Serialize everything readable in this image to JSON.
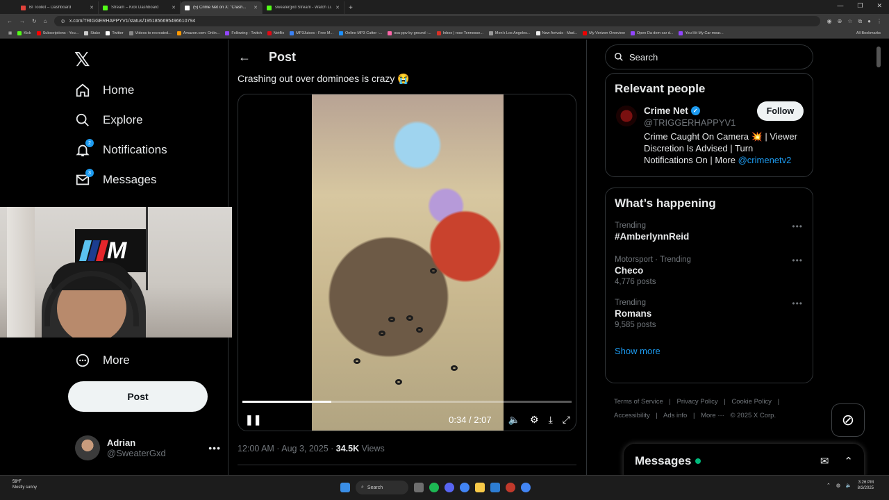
{
  "browser": {
    "tabs": [
      {
        "label": "BI Toolkit – Dashboard",
        "color": "#e0433b",
        "active": false
      },
      {
        "label": "Stream – Kick Dashboard",
        "color": "#53fc18",
        "active": false
      },
      {
        "label": "(5) Crime Net on X: \"Crash...",
        "color": "#ffffff",
        "active": true
      },
      {
        "label": "sweatergxd Stream - Watch Li...",
        "color": "#53fc18",
        "active": false
      }
    ],
    "url": "x.com/TRIGGERHAPPYV1/status/1951856695496610794",
    "bookmarks": [
      {
        "label": "Kick",
        "color": "#53fc18"
      },
      {
        "label": "Subscriptions - You...",
        "color": "#ff0000"
      },
      {
        "label": "Stake",
        "color": "#cccccc"
      },
      {
        "label": "Twitter",
        "color": "#ffffff"
      },
      {
        "label": "Videos to recreated...",
        "color": "#888888"
      },
      {
        "label": "Amazon.com: Onlin...",
        "color": "#ff9900"
      },
      {
        "label": "Following - Twitch",
        "color": "#9146ff"
      },
      {
        "label": "Netflix",
        "color": "#e50914"
      },
      {
        "label": "MP3Juices - Free M...",
        "color": "#3b82f6"
      },
      {
        "label": "Online MP3 Cutter -...",
        "color": "#1e90ff"
      },
      {
        "label": "osu-ppv by ground -...",
        "color": "#ff66aa"
      },
      {
        "label": "Inbox | rose Tennesse...",
        "color": "#d93025"
      },
      {
        "label": "Men's Los Angeles...",
        "color": "#999999"
      },
      {
        "label": "New Arrivals - Mad...",
        "color": "#eeeeee"
      },
      {
        "label": "My Verizon Overview",
        "color": "#ee0000"
      },
      {
        "label": "Open Da dem car d...",
        "color": "#9146ff"
      },
      {
        "label": "You Hit My Car mear...",
        "color": "#9146ff"
      }
    ],
    "all_bookmarks": "All Bookmarks"
  },
  "nav": {
    "items": [
      {
        "label": "Home",
        "icon": "home-icon"
      },
      {
        "label": "Explore",
        "icon": "search-icon"
      },
      {
        "label": "Notifications",
        "icon": "bell-icon",
        "badge": "2"
      },
      {
        "label": "Messages",
        "icon": "mail-icon",
        "badge": "3"
      },
      {
        "label": "More",
        "icon": "more-circle-icon"
      }
    ],
    "post_button": "Post",
    "account": {
      "display_name": "Adrian",
      "handle": "@SweaterGxd"
    }
  },
  "main": {
    "header_title": "Post",
    "post_text": "Crashing out over dominoes is crazy 😭",
    "video": {
      "current_time": "0:34",
      "duration": "2:07",
      "progress": 0.27
    },
    "timestamp": "12:00 AM · Aug 3, 2025 · ",
    "views_count": "34.5K",
    "views_label": " Views"
  },
  "sidebar": {
    "search_placeholder": "Search",
    "relevant_title": "Relevant people",
    "person": {
      "name": "Crime Net",
      "handle": "@TRIGGERHAPPYV1",
      "bio": "Crime Caught On Camera 💥 | Viewer Discretion Is Advised | Turn Notifications On | More ",
      "bio_link": "@crimenetv2",
      "follow_label": "Follow"
    },
    "happening_title": "What’s happening",
    "trends": [
      {
        "context": "Trending",
        "name": "#AmberlynnReid",
        "posts": ""
      },
      {
        "context": "Motorsport · Trending",
        "name": "Checo",
        "posts": "4,776 posts"
      },
      {
        "context": "Trending",
        "name": "Romans",
        "posts": "9,585 posts"
      }
    ],
    "show_more": "Show more",
    "footer": [
      "Terms of Service",
      "|",
      "Privacy Policy",
      "|",
      "Cookie Policy",
      "|",
      "Accessibility",
      "|",
      "Ads info",
      "|",
      "More ···",
      "© 2025 X Corp."
    ],
    "messages_drawer": "Messages"
  },
  "taskbar": {
    "weather_temp": "59°F",
    "weather_desc": "Mostly sunny",
    "search_label": "Search",
    "time": "3:26 PM",
    "date": "8/3/2025"
  },
  "colors": {
    "accent": "#1d9bf0",
    "background": "#000000",
    "online": "#00ba7c"
  }
}
